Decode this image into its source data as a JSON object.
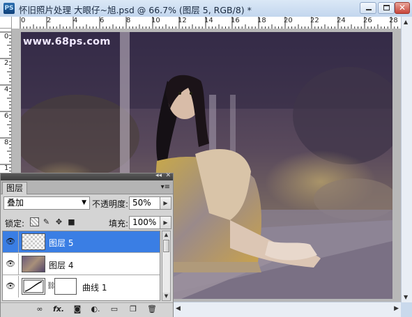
{
  "titlebar": {
    "app_icon": "PS",
    "title": "怀旧照片处理 大眼仔~旭.psd @ 66.7% (图层 5, RGB/8) *"
  },
  "ruler": {
    "top_ticks": [
      "0",
      "2",
      "4",
      "6",
      "8",
      "10",
      "12",
      "14",
      "16",
      "18",
      "20",
      "22",
      "24",
      "26",
      "28"
    ],
    "left_ticks": [
      "0",
      "2",
      "4",
      "6",
      "8",
      "1"
    ]
  },
  "canvas": {
    "watermark": "www.68ps.com"
  },
  "layers_panel": {
    "tab_label": "图层",
    "menu_icon": "▾≡",
    "collapse_icon": "◂◂",
    "close_icon": "✕",
    "blend_mode": "叠加",
    "opacity_label": "不透明度:",
    "opacity_value": "50%",
    "lock_label": "锁定:",
    "fill_label": "填充:",
    "fill_value": "100%",
    "layers": [
      {
        "name": "图层 5",
        "selected": true,
        "thumbnail": "transparent"
      },
      {
        "name": "图层 4",
        "selected": false,
        "thumbnail": "photo"
      },
      {
        "name": "曲线 1",
        "selected": false,
        "thumbnail": "curves-adjustment"
      }
    ],
    "toolbar_icons": [
      "link-icon",
      "fx-icon",
      "mask-icon",
      "adjustment-icon",
      "folder-icon",
      "new-layer-icon",
      "trash-icon"
    ]
  },
  "colors": {
    "selected_row": "#3a7ee4",
    "window_chrome": "#c9d9ec",
    "watermark": "#f0e8ff"
  }
}
